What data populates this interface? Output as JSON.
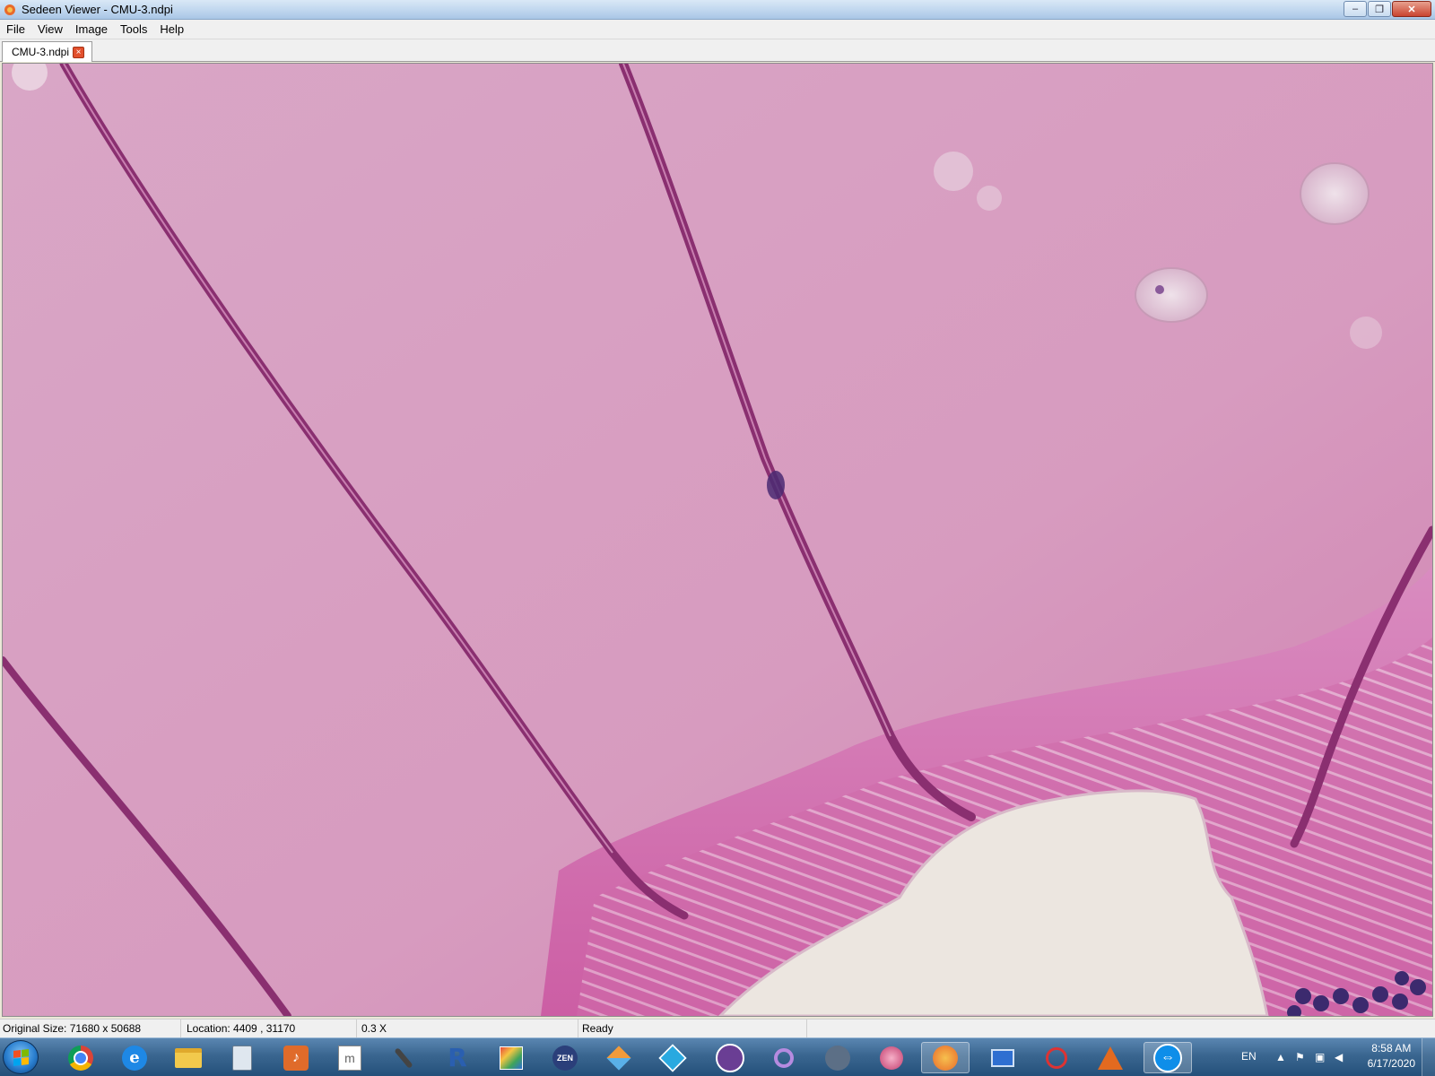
{
  "window": {
    "title": "Sedeen Viewer - CMU-3.ndpi"
  },
  "window_controls": {
    "minimize": "–",
    "restore": "❐",
    "close": "✕"
  },
  "menu": {
    "items": [
      "File",
      "View",
      "Image",
      "Tools",
      "Help"
    ]
  },
  "tabs": [
    {
      "label": "CMU-3.ndpi",
      "close_glyph": "×"
    }
  ],
  "viewer": {
    "content": "histology slide image (H&E stained tissue)"
  },
  "status": {
    "original_size": "Original Size: 71680 x 50688",
    "location": "Location: 4409 , 31170",
    "zoom": "0.3 X",
    "state": "Ready"
  },
  "taskbar": {
    "apps": [
      "start-orb",
      "chrome-icon",
      "internet-explorer-icon",
      "file-explorer-icon",
      "calculator-icon",
      "volume-mixer-icon",
      "text-editor-icon",
      "microphone-icon",
      "r-icon",
      "image-viewer-icon",
      "zen-icon",
      "cubes-icon",
      "prism-icon",
      "cat-icon",
      "magnifier-icon",
      "qupath-icon",
      "slide-icon",
      "sedeen-icon",
      "remote-desktop-icon",
      "snipping-icon",
      "matlab-icon",
      "teamviewer-icon"
    ],
    "zen_label": "ZEN",
    "r_label": "R",
    "active_app": "sedeen-icon"
  },
  "tray": {
    "language": "EN",
    "time": "8:58 AM",
    "date": "6/17/2020"
  },
  "colors": {
    "tissue_pink": "#d89fc1",
    "fiber_purple": "#8a2f70",
    "lumen_white": "#ece6e0",
    "nuclei_dark": "#3c2a6e",
    "taskbar_blue": "#2e5c88"
  }
}
